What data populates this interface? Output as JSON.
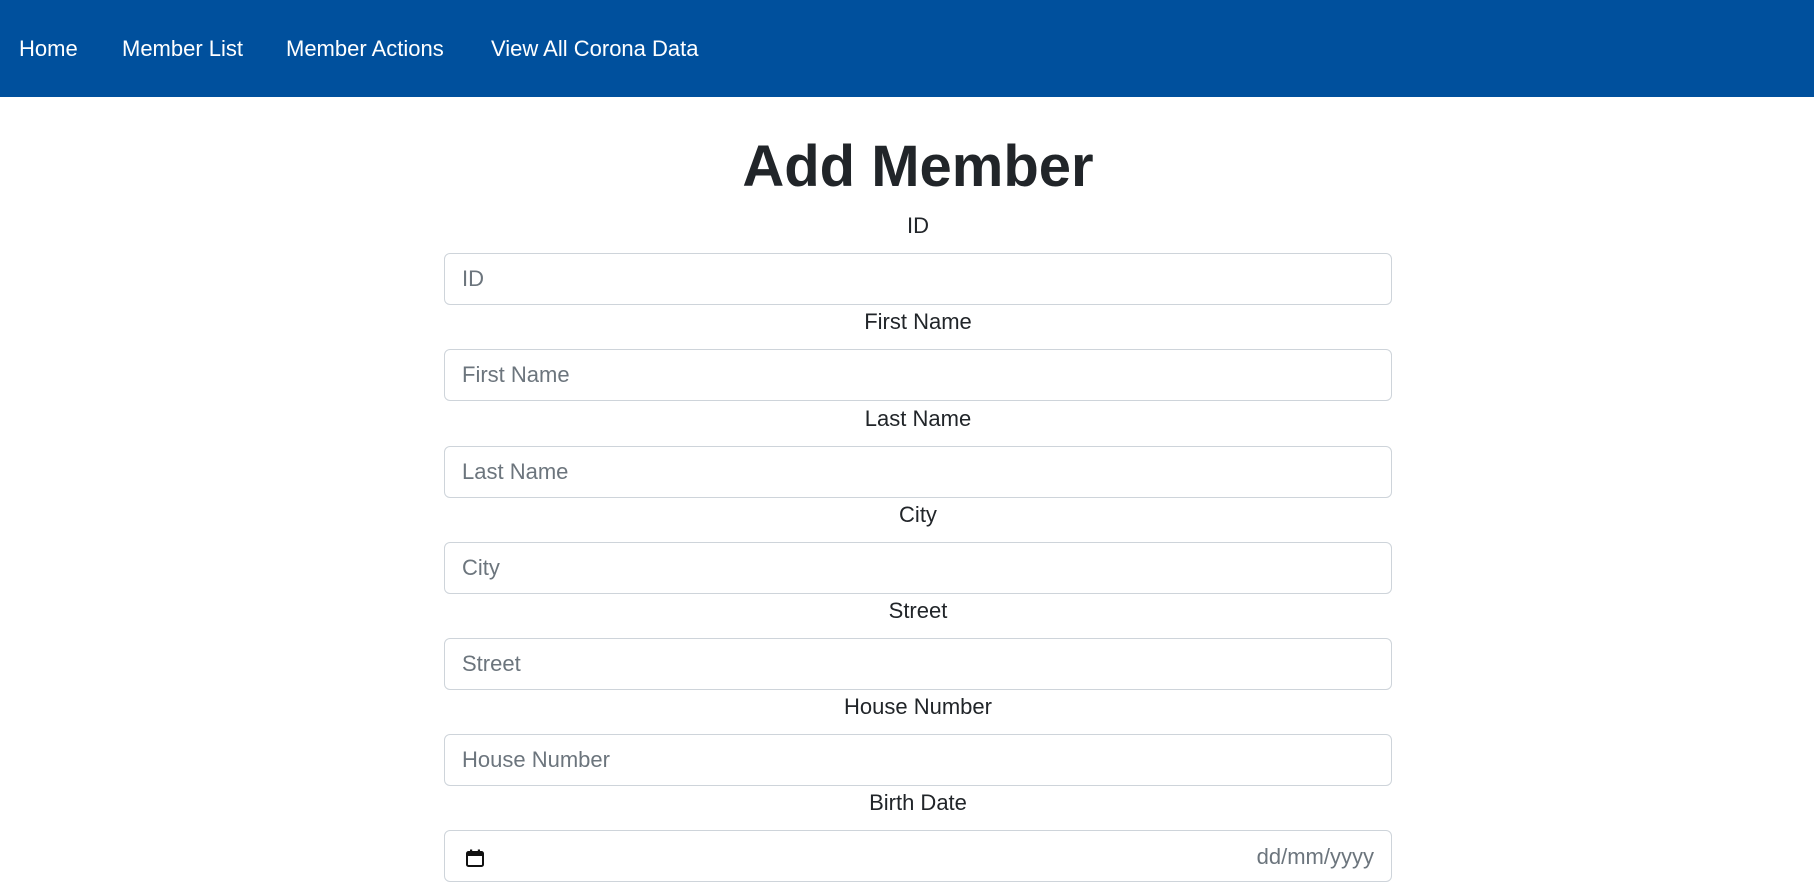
{
  "nav": {
    "home": "Home",
    "member_list": "Member List",
    "member_actions": "Member Actions",
    "corona_data": "View All Corona Data",
    "background_color": "#00509d"
  },
  "form": {
    "title": "Add Member",
    "fields": [
      {
        "label": "ID",
        "placeholder": "ID",
        "value": ""
      },
      {
        "label": "First Name",
        "placeholder": "First Name",
        "value": ""
      },
      {
        "label": "Last Name",
        "placeholder": "Last Name",
        "value": ""
      },
      {
        "label": "City",
        "placeholder": "City",
        "value": ""
      },
      {
        "label": "Street",
        "placeholder": "Street",
        "value": ""
      },
      {
        "label": "House Number",
        "placeholder": "House Number",
        "value": ""
      }
    ],
    "birth_date": {
      "label": "Birth Date",
      "placeholder": "dd/mm/yyyy",
      "icon": "calendar-icon"
    }
  }
}
